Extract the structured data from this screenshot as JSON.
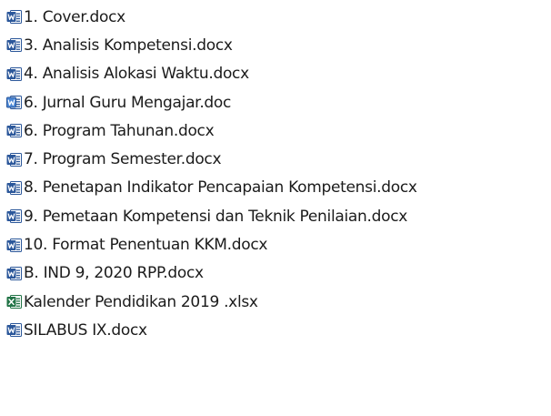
{
  "files": [
    {
      "name": "1. Cover.docx",
      "icon": "word-doc-icon"
    },
    {
      "name": "3. Analisis Kompetensi.docx",
      "icon": "word-doc-icon"
    },
    {
      "name": "4. Analisis Alokasi Waktu.docx",
      "icon": "word-doc-icon"
    },
    {
      "name": "6. Jurnal Guru Mengajar.doc",
      "icon": "word-doc-legacy-icon"
    },
    {
      "name": "6. Program Tahunan.docx",
      "icon": "word-doc-icon"
    },
    {
      "name": "7. Program Semester.docx",
      "icon": "word-doc-icon"
    },
    {
      "name": "8. Penetapan Indikator Pencapaian Kompetensi.docx",
      "icon": "word-doc-icon"
    },
    {
      "name": "9. Pemetaan Kompetensi dan Teknik Penilaian.docx",
      "icon": "word-doc-icon"
    },
    {
      "name": "10. Format Penentuan KKM.docx",
      "icon": "word-doc-icon"
    },
    {
      "name": "B. IND 9, 2020 RPP.docx",
      "icon": "word-doc-icon"
    },
    {
      "name": "Kalender Pendidikan 2019 .xlsx",
      "icon": "excel-sheet-icon"
    },
    {
      "name": "SILABUS IX.docx",
      "icon": "word-doc-icon"
    }
  ],
  "colors": {
    "word": "#2b579a",
    "word_light": "#4a86d4",
    "excel": "#217346",
    "excel_light": "#33a15e"
  }
}
